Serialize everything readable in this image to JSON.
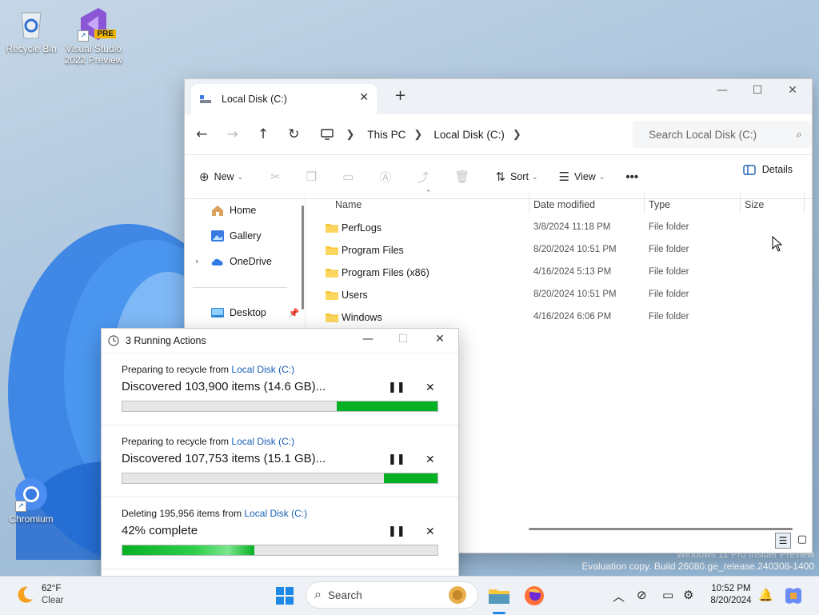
{
  "desktop": {
    "icons": [
      {
        "label": "Recycle Bin"
      },
      {
        "label_line1": "Visual Studio",
        "label_line2": "2022 Preview",
        "badge": "PRE"
      },
      {
        "label": "Chromium"
      }
    ],
    "watermark": {
      "line1": "Windows 11 Pro Insider Preview",
      "line2": "Evaluation copy. Build 26080.ge_release.240308-1400"
    }
  },
  "explorer": {
    "tab_title": "Local Disk (C:)",
    "breadcrumb": [
      "This PC",
      "Local Disk (C:)"
    ],
    "search_placeholder": "Search Local Disk (C:)",
    "commands": {
      "new": "New",
      "sort": "Sort",
      "view": "View",
      "details": "Details"
    },
    "nav": [
      {
        "label": "Home"
      },
      {
        "label": "Gallery"
      },
      {
        "label": "OneDrive"
      },
      {
        "label": "Desktop"
      }
    ],
    "columns": [
      "Name",
      "Date modified",
      "Type",
      "Size"
    ],
    "rows": [
      {
        "name": "PerfLogs",
        "date": "3/8/2024 11:18 PM",
        "type": "File folder"
      },
      {
        "name": "Program Files",
        "date": "8/20/2024 10:51 PM",
        "type": "File folder"
      },
      {
        "name": "Program Files (x86)",
        "date": "4/16/2024 5:13 PM",
        "type": "File folder"
      },
      {
        "name": "Users",
        "date": "8/20/2024 10:51 PM",
        "type": "File folder"
      },
      {
        "name": "Windows",
        "date": "4/16/2024 6:06 PM",
        "type": "File folder"
      }
    ]
  },
  "dialog": {
    "title": "3 Running Actions",
    "operations": [
      {
        "prefix": "Preparing to recycle from",
        "link": "Local Disk (C:)",
        "status": "Discovered 103,900 items (14.6 GB)...",
        "bar_start": 0.68,
        "bar_end": 1.0
      },
      {
        "prefix": "Preparing to recycle from",
        "link": "Local Disk (C:)",
        "status": "Discovered 107,753 items (15.1 GB)...",
        "bar_start": 0.83,
        "bar_end": 1.0
      },
      {
        "prefix": "Deleting 195,956 items from",
        "link": "Local Disk (C:)",
        "status": "42% complete",
        "bar_start": 0.0,
        "bar_end": 0.42
      }
    ]
  },
  "taskbar": {
    "weather_temp": "62°F",
    "weather_cond": "Clear",
    "search_label": "Search",
    "time": "10:52 PM",
    "date": "8/20/2024"
  },
  "colors": {
    "accent": "#1a5fb4",
    "progress": "#06b025",
    "folder": "#f8c73e"
  }
}
